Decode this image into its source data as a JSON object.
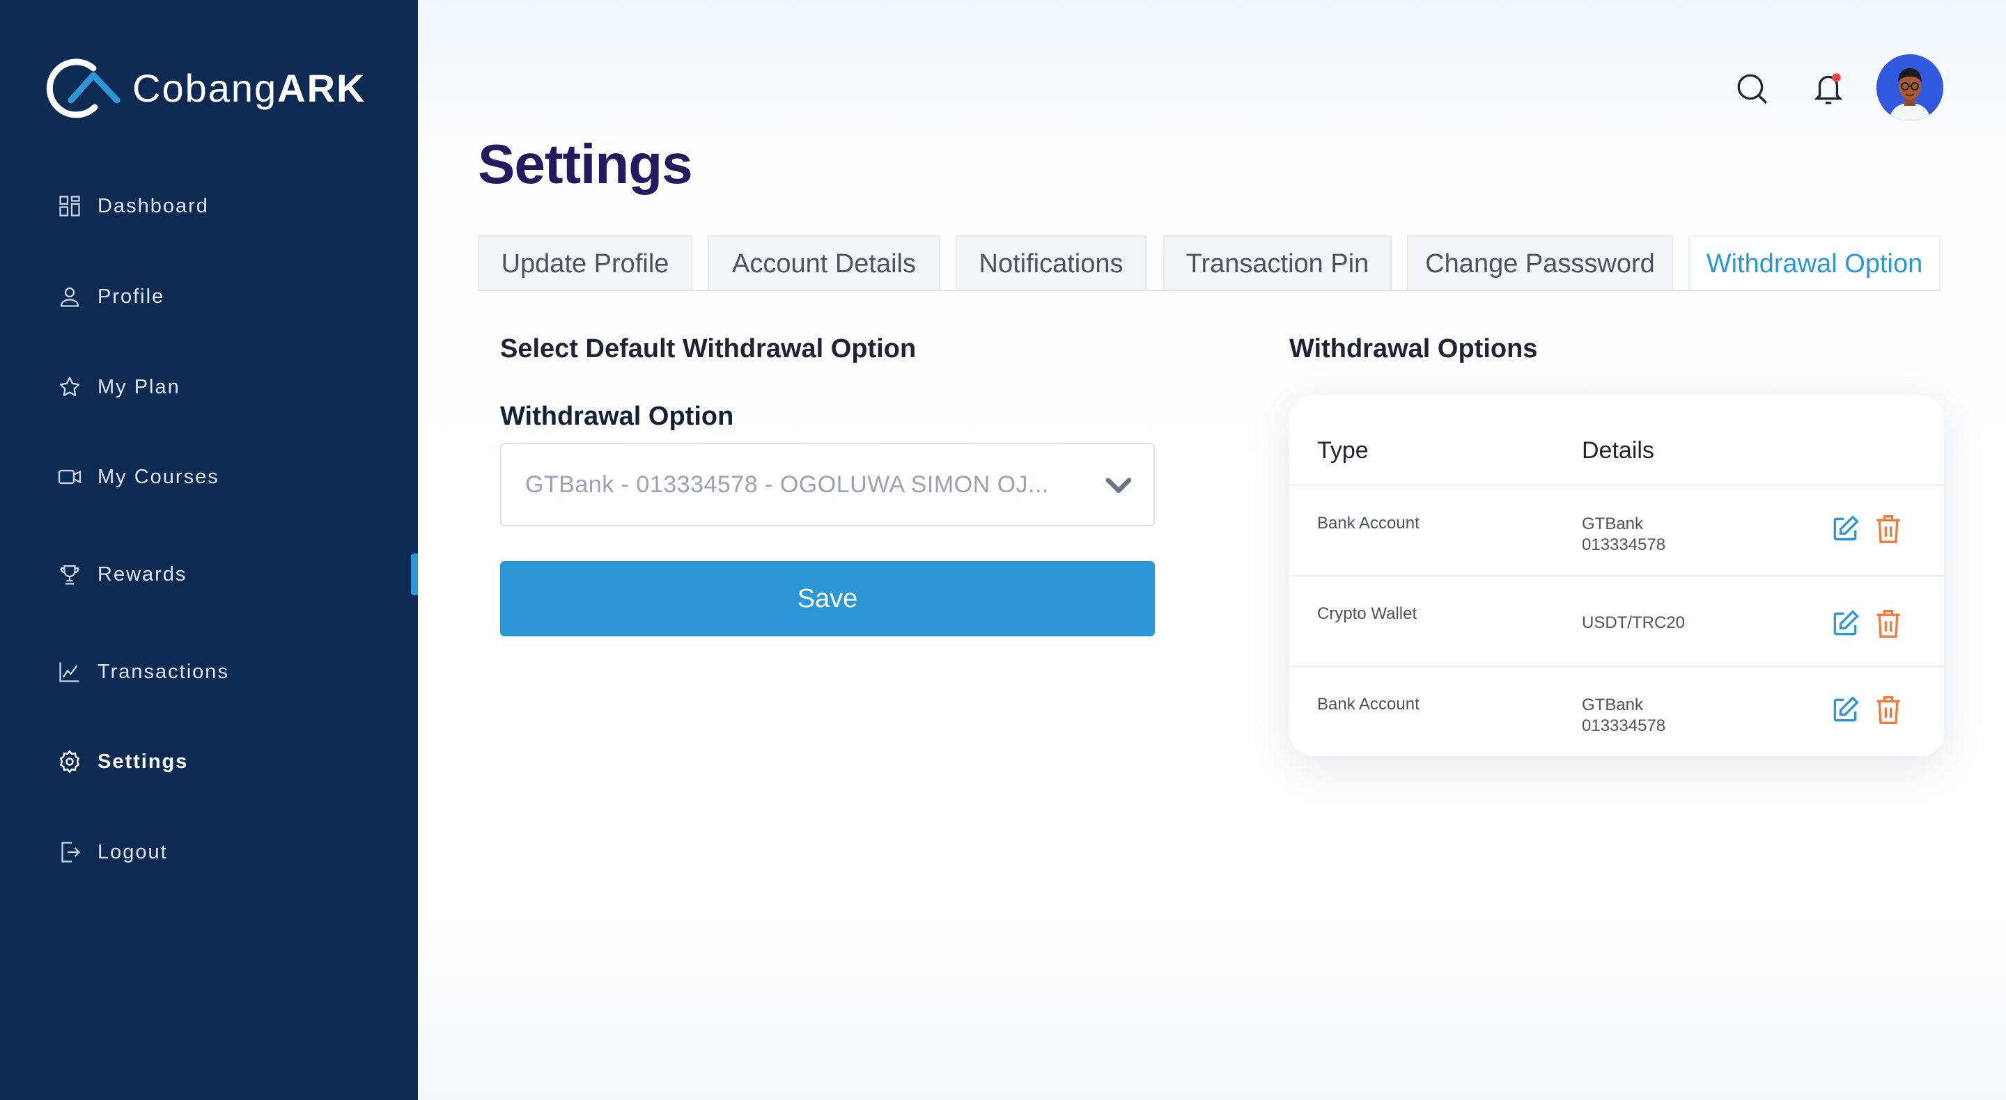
{
  "brand": {
    "name_light": "Cobang",
    "name_bold": "ARK"
  },
  "sidebar": {
    "items": [
      {
        "label": "Dashboard",
        "icon": "grid-icon"
      },
      {
        "label": "Profile",
        "icon": "user-icon"
      },
      {
        "label": "My Plan",
        "icon": "star-icon"
      },
      {
        "label": "My Courses",
        "icon": "video-icon"
      },
      {
        "label": "Rewards",
        "icon": "trophy-icon"
      },
      {
        "label": "Transactions",
        "icon": "chart-icon"
      },
      {
        "label": "Settings",
        "icon": "gear-icon"
      },
      {
        "label": "Logout",
        "icon": "logout-icon"
      }
    ],
    "active": "Settings"
  },
  "header": {
    "icons": [
      "search-icon",
      "bell-icon",
      "avatar"
    ]
  },
  "page": {
    "title": "Settings"
  },
  "tabs": [
    {
      "label": "Update Profile"
    },
    {
      "label": "Account Details"
    },
    {
      "label": "Notifications"
    },
    {
      "label": "Transaction Pin"
    },
    {
      "label": "Change Passsword"
    },
    {
      "label": "Withdrawal Option"
    }
  ],
  "left_panel": {
    "heading": "Select Default Withdrawal Option",
    "field_label": "Withdrawal Option",
    "selected_value": "GTBank - 013334578 - OGOLUWA SIMON OJ...",
    "save_label": "Save"
  },
  "right_panel": {
    "heading": "Withdrawal Options",
    "columns": {
      "type": "Type",
      "details": "Details"
    },
    "rows": [
      {
        "type": "Bank Account",
        "details_line1": "GTBank",
        "details_line2": "013334578"
      },
      {
        "type": "Crypto Wallet",
        "details_line1": "USDT/TRC20",
        "details_line2": ""
      },
      {
        "type": "Bank Account",
        "details_line1": "GTBank",
        "details_line2": "013334578"
      }
    ]
  },
  "colors": {
    "sidebar_bg": "#0c2a52",
    "accent": "#2b97d6",
    "title": "#22195e",
    "delete": "#f07a3a",
    "notification_dot": "#ef4444"
  }
}
